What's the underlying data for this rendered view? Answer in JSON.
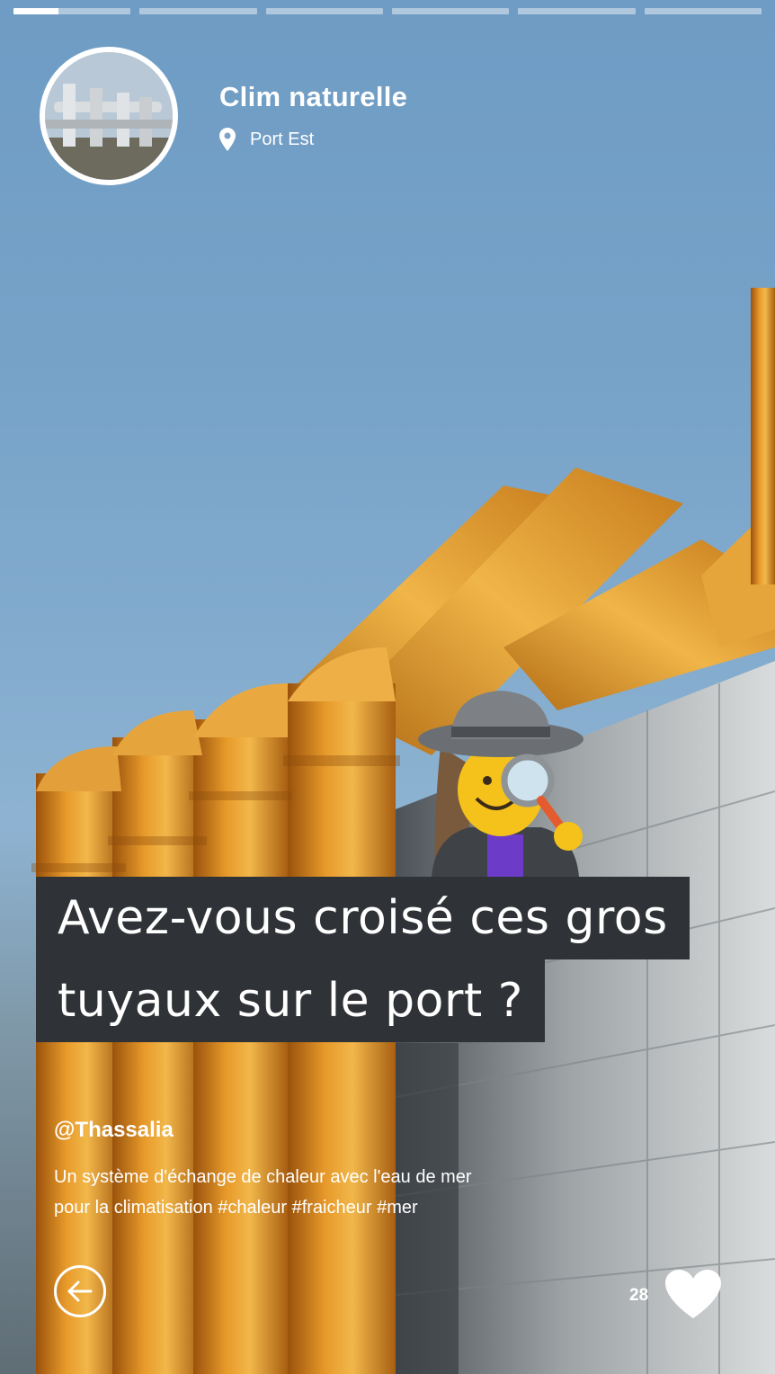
{
  "story": {
    "segments_total": 6,
    "active_segment_progress": 0.38,
    "title": "Clim naturelle",
    "location": "Port Est",
    "headline_line1": "Avez-vous croisé ces gros",
    "headline_line2": "tuyaux sur le port ?",
    "author": "@Thassalia",
    "description_line1": "Un système d'échange de chaleur avec l'eau de mer",
    "description_line2": "pour la climatisation #chaleur #fraicheur #mer",
    "likes": "28"
  },
  "icons": {
    "location": "map-pin-icon",
    "back": "arrow-left-circle-icon",
    "like": "heart-icon",
    "sticker": "detective-emoji"
  },
  "colors": {
    "sky": "#76a2c8",
    "pipes": "#d98a1c",
    "headline_bg": "#2f3236",
    "text": "#ffffff"
  }
}
